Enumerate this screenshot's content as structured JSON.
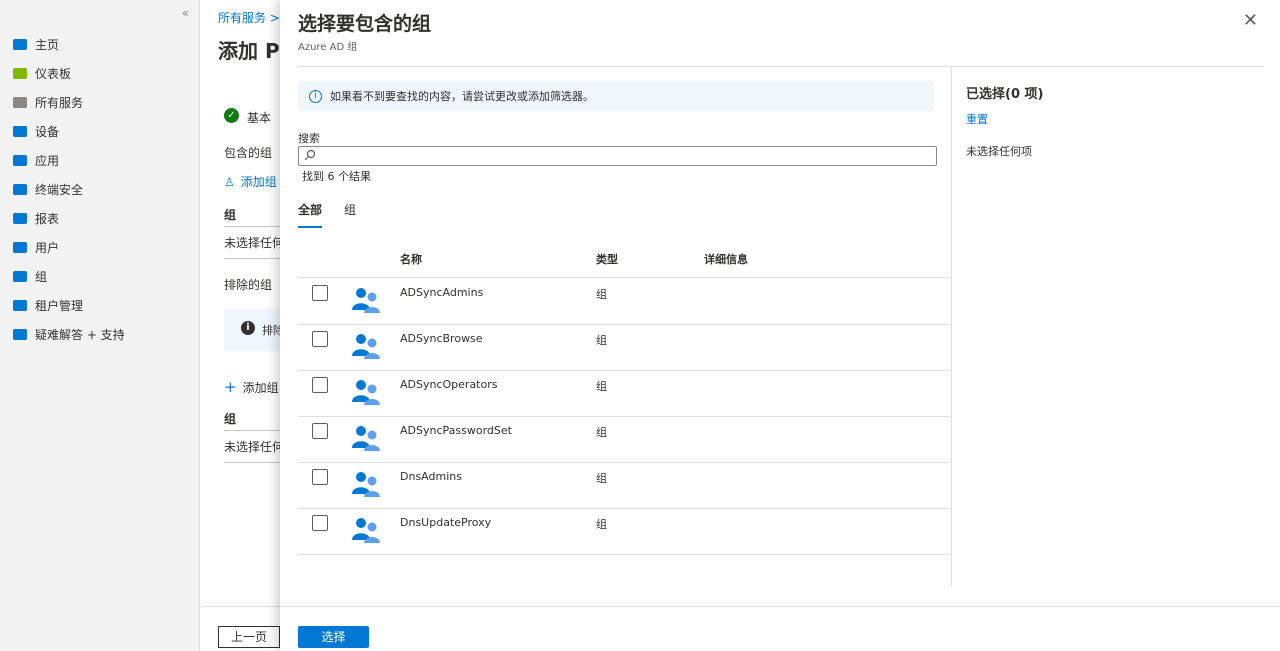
{
  "nav": {
    "collapse_label": "«",
    "items": [
      {
        "label": "主页",
        "icon": "home-icon",
        "color": "#0078d4"
      },
      {
        "label": "仪表板",
        "icon": "dashboard-icon",
        "color": "#7fba00"
      },
      {
        "label": "所有服务",
        "icon": "list-icon",
        "color": "#8a8886"
      },
      {
        "label": "设备",
        "icon": "device-icon",
        "color": "#0078d4"
      },
      {
        "label": "应用",
        "icon": "apps-icon",
        "color": "#0078d4"
      },
      {
        "label": "终端安全",
        "icon": "shield-icon",
        "color": "#0078d4"
      },
      {
        "label": "报表",
        "icon": "report-icon",
        "color": "#0078d4"
      },
      {
        "label": "用户",
        "icon": "user-icon",
        "color": "#0078d4"
      },
      {
        "label": "组",
        "icon": "group-icon",
        "color": "#0078d4"
      },
      {
        "label": "租户管理",
        "icon": "tenant-icon",
        "color": "#0078d4"
      },
      {
        "label": "疑难解答 + 支持",
        "icon": "troubleshoot-icon",
        "color": "#0078d4"
      }
    ]
  },
  "background": {
    "breadcrumb": "所有服务 >",
    "title": "添加 P",
    "step_label": "基本",
    "included_groups_label": "包含的组",
    "add_included_label": "添加组",
    "group_col": "组",
    "none_selected": "未选择任何项",
    "excluded_groups_label": "排除的组",
    "excluded_info": "排除",
    "add_excluded_label": "添加组",
    "group_col2": "组",
    "none_selected2": "未选择任何项",
    "prev_button": "上一页"
  },
  "panel": {
    "title": "选择要包含的组",
    "subtitle": "Azure AD 组",
    "close_label": "✕",
    "info_banner": "如果看不到要查找的内容，请尝试更改或添加筛选器。",
    "search_label": "搜索",
    "search_value": "",
    "result_count": "找到 6 个结果",
    "tabs": [
      {
        "label": "全部",
        "active": true
      },
      {
        "label": "组",
        "active": false
      }
    ],
    "columns": {
      "name": "名称",
      "type": "类型",
      "details": "详细信息"
    },
    "rows": [
      {
        "name": "ADSyncAdmins",
        "type": "组",
        "details": ""
      },
      {
        "name": "ADSyncBrowse",
        "type": "组",
        "details": ""
      },
      {
        "name": "ADSyncOperators",
        "type": "组",
        "details": ""
      },
      {
        "name": "ADSyncPasswordSet",
        "type": "组",
        "details": ""
      },
      {
        "name": "DnsAdmins",
        "type": "组",
        "details": ""
      },
      {
        "name": "DnsUpdateProxy",
        "type": "组",
        "details": ""
      }
    ],
    "selected_title": "已选择(0 项)",
    "reset_label": "重置",
    "no_selection": "未选择任何项",
    "select_button": "选择"
  },
  "colors": {
    "accent": "#0078d4",
    "success": "#107c10"
  }
}
